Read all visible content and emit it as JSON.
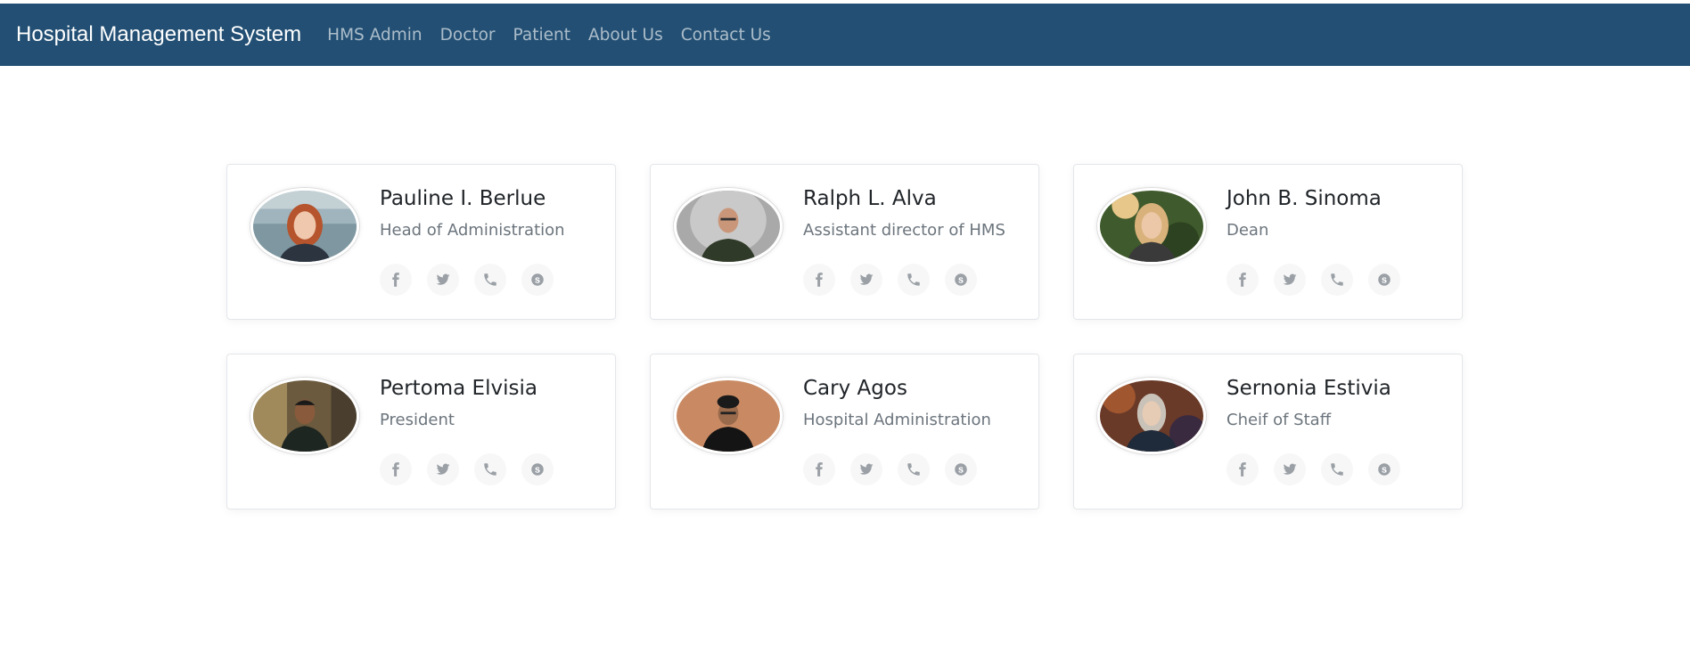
{
  "navbar": {
    "brand": "Hospital Management System",
    "links": [
      "HMS Admin",
      "Doctor",
      "Patient",
      "About Us",
      "Contact Us"
    ]
  },
  "staff": [
    {
      "name": "Pauline I. Berlue",
      "role": "Head of Administration",
      "avatar_icon": "woman-red-hair-portrait"
    },
    {
      "name": "Ralph L. Alva",
      "role": "Assistant director of HMS",
      "avatar_icon": "bald-man-portrait"
    },
    {
      "name": "John B. Sinoma",
      "role": "Dean",
      "avatar_icon": "woman-blonde-portrait"
    },
    {
      "name": "Pertoma Elvisia",
      "role": "President",
      "avatar_icon": "man-forest-portrait"
    },
    {
      "name": "Cary Agos",
      "role": "Hospital Administration",
      "avatar_icon": "man-hat-portrait"
    },
    {
      "name": "Sernonia Estivia",
      "role": "Cheif of Staff",
      "avatar_icon": "woman-autumn-portrait"
    }
  ],
  "social_icons": [
    "facebook-icon",
    "twitter-icon",
    "phone-icon",
    "skype-icon"
  ],
  "colors": {
    "navbar": "#224f73",
    "icon": "#9aa0a6",
    "icon_bg": "#f7f7f7"
  }
}
